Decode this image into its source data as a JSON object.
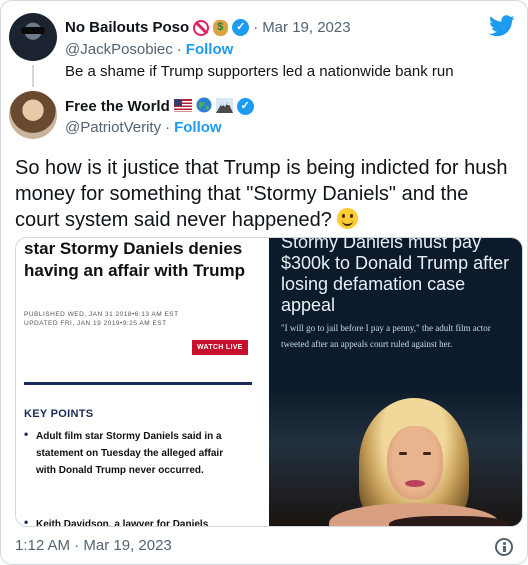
{
  "quoted_tweet": {
    "author_name": "No Bailouts Poso",
    "handle": "@JackPosobiec",
    "follow_label": "Follow",
    "separator": "·",
    "date": "Mar 19, 2023",
    "text": "Be a shame if Trump supporters led a nationwide bank run",
    "name_emojis": [
      "no-entry-icon",
      "money-bag-icon"
    ]
  },
  "main_tweet": {
    "author_name": "Free the World",
    "name_emojis": [
      "us-flag-icon",
      "globe-icon",
      "mountain-icon"
    ],
    "handle": "@PatriotVerity",
    "follow_label": "Follow",
    "separator": "·",
    "text": "So how is it justice that Trump is being indicted for hush money for something that \"Stormy Daniels\" and the court system said never happened?",
    "text_emoji": "smile-emoji-icon"
  },
  "media_left": {
    "headline": "star Stormy Daniels denies having an affair with Trump",
    "published": "PUBLISHED WED, JAN 31 2018•6:13 AM EST",
    "updated": "UPDATED FRI, JAN 19 2019•9:25 AM EST",
    "watch_live": "WATCH LIVE",
    "key_points_label": "KEY POINTS",
    "bullets": [
      "Adult film star Stormy Daniels said in a statement on Tuesday the alleged affair with Donald Trump never occurred.",
      "Keith Davidson, a lawyer for Daniels"
    ]
  },
  "media_right": {
    "headline": "Stormy Daniels must pay $300k to Donald Trump after losing defamation case appeal",
    "quote": "\"I will go to jail before I pay a penny,\" the adult film actor tweeted after an appeals court ruled against her."
  },
  "footer": {
    "timestamp": "1:12 AM · Mar 19, 2023"
  },
  "colors": {
    "accent": "#1d9bf0",
    "text": "#0f1419",
    "muted": "#536471",
    "border": "#cfd9de"
  }
}
